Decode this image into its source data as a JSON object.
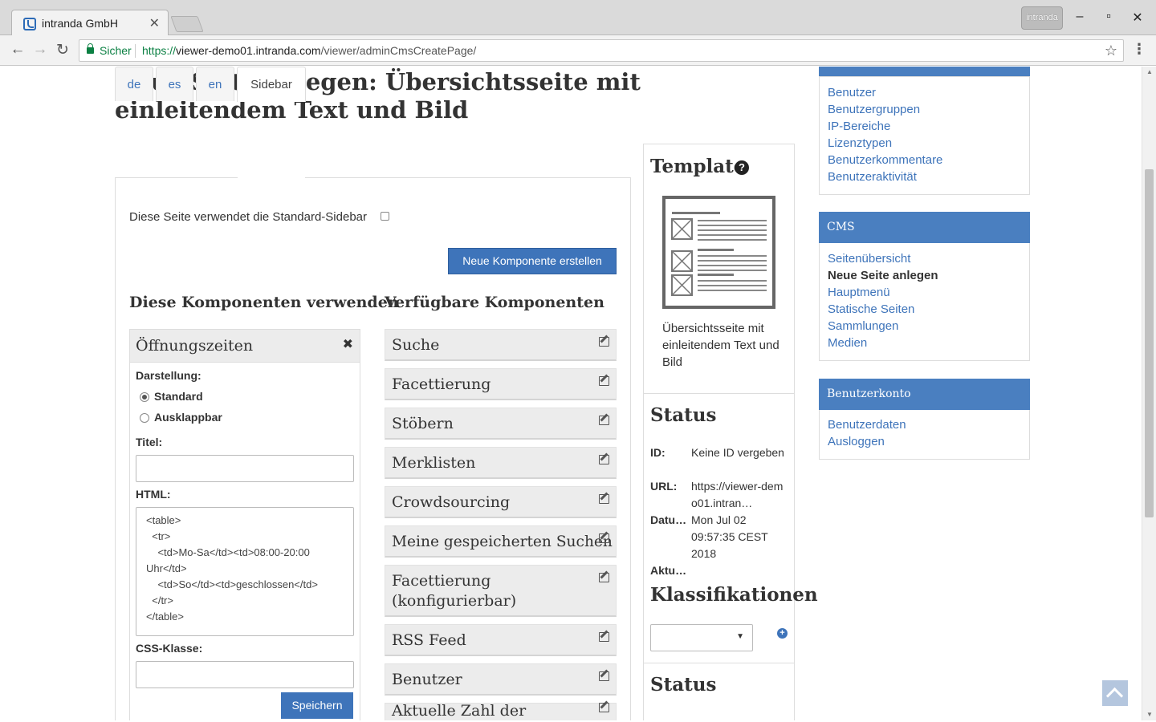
{
  "browser": {
    "tab_title": "intranda GmbH",
    "profile_label": "intranda",
    "secure_label": "Sicher",
    "url_scheme": "https://",
    "url_host": "viewer-demo01.intranda.com",
    "url_path": "/viewer/adminCmsCreatePage/"
  },
  "page": {
    "title": "Neue Seite anlegen: Übersichtsseite mit einleitendem Text und Bild",
    "lang_tabs": [
      "de",
      "es",
      "en",
      "Sidebar"
    ],
    "active_tab": "Sidebar",
    "standard_sidebar_label": "Diese Seite verwendet die Standard-Sidebar",
    "standard_sidebar_checked": false,
    "new_component_button": "Neue Komponente erstellen",
    "used_heading": "Diese Komponenten verwenden",
    "available_heading": "Verfügbare Komponenten",
    "used_component": {
      "title": "Öffnungszeiten",
      "display_label": "Darstellung:",
      "display_options": [
        "Standard",
        "Ausklappbar"
      ],
      "display_selected": "Standard",
      "title_label": "Titel:",
      "title_value": "",
      "html_label": "HTML:",
      "html_value": "<table>\n  <tr>\n    <td>Mo-Sa</td><td>08:00-20:00 Uhr</td>\n    <td>So</td><td>geschlossen</td>\n  </tr>\n</table>",
      "css_label": "CSS-Klasse:",
      "css_value": "",
      "save_button": "Speichern"
    },
    "available_components": [
      "Suche",
      "Facettierung",
      "Stöbern",
      "Merklisten",
      "Crowdsourcing",
      "Meine gespeicherten Suchen",
      "Facettierung (konfigurierbar)",
      "RSS Feed",
      "Benutzer",
      "Aktuelle Zahl der"
    ]
  },
  "template_box": {
    "heading": "Template",
    "description": "Übersichtsseite mit einleitendem Text und Bild",
    "status_heading": "Status",
    "status": {
      "id_key": "ID:",
      "id_value": "Keine ID vergeben",
      "url_key": "URL:",
      "url_value": "https://viewer-demo01.intran…",
      "date_key": "Datu…",
      "date_value": "Mon Jul 02 09:57:35 CEST 2018",
      "updated_key": "Aktu…"
    },
    "classifications_heading": "Klassifikationen",
    "classification_selected": "",
    "status2_heading": "Status"
  },
  "sidebar": {
    "users_links": [
      "Benutzer",
      "Benutzergruppen",
      "IP-Bereiche",
      "Lizenztypen",
      "Benutzerkommentare",
      "Benutzeraktivität"
    ],
    "cms_heading": "CMS",
    "cms_links": [
      "Seitenübersicht",
      "Neue Seite anlegen",
      "Hauptmenü",
      "Statische Seiten",
      "Sammlungen",
      "Medien"
    ],
    "cms_current": "Neue Seite anlegen",
    "account_heading": "Benutzerkonto",
    "account_links": [
      "Benutzerdaten",
      "Ausloggen"
    ]
  },
  "colors": {
    "primary": "#3e74ba",
    "panel_header": "#4a7fc0",
    "secure_green": "#0b8043"
  }
}
